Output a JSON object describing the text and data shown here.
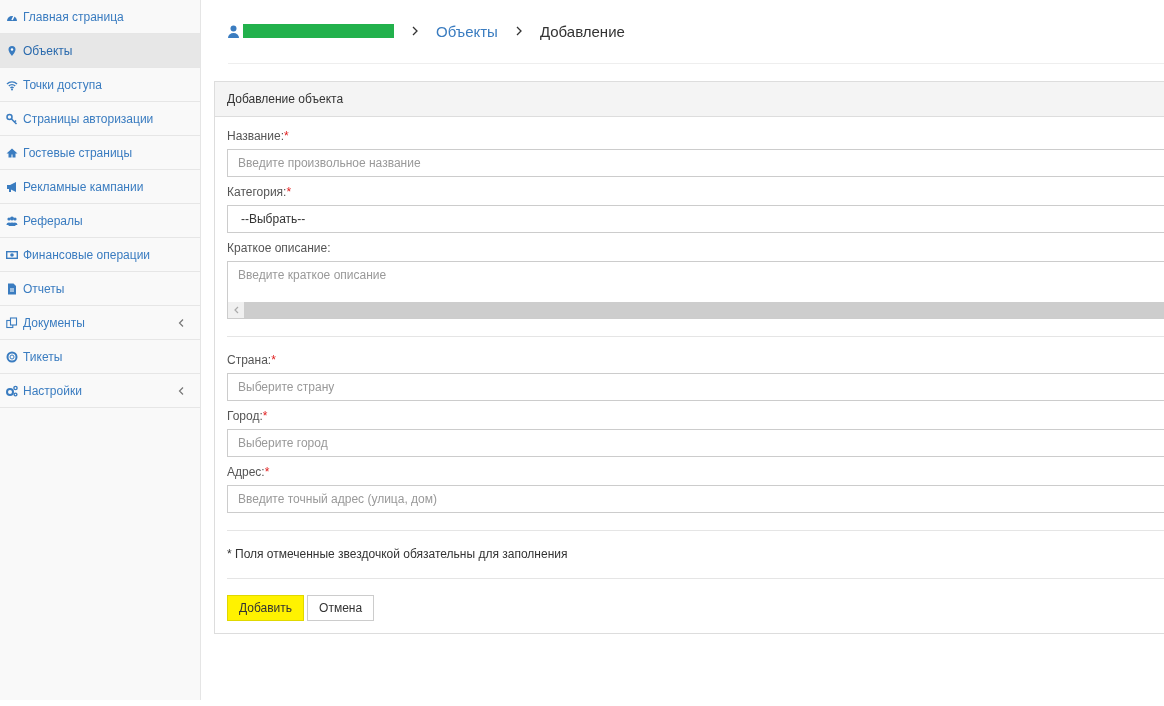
{
  "sidebar": {
    "items": [
      {
        "label": "Главная страница",
        "selected": false,
        "has_submenu": false
      },
      {
        "label": "Объекты",
        "selected": true,
        "has_submenu": false
      },
      {
        "label": "Точки доступа",
        "selected": false,
        "has_submenu": false
      },
      {
        "label": "Страницы авторизации",
        "selected": false,
        "has_submenu": false
      },
      {
        "label": "Гостевые страницы",
        "selected": false,
        "has_submenu": false
      },
      {
        "label": "Рекламные кампании",
        "selected": false,
        "has_submenu": false
      },
      {
        "label": "Рефералы",
        "selected": false,
        "has_submenu": false
      },
      {
        "label": "Финансовые операции",
        "selected": false,
        "has_submenu": false
      },
      {
        "label": "Отчеты",
        "selected": false,
        "has_submenu": false
      },
      {
        "label": "Документы",
        "selected": false,
        "has_submenu": true
      },
      {
        "label": "Тикеты",
        "selected": false,
        "has_submenu": false
      },
      {
        "label": "Настройки",
        "selected": false,
        "has_submenu": true
      }
    ]
  },
  "breadcrumb": {
    "items": [
      {
        "label": "Объекты",
        "kind": "link"
      },
      {
        "label": "Добавление",
        "kind": "current"
      }
    ]
  },
  "form": {
    "title": "Добавление объекта",
    "groups": [
      [
        {
          "label": "Название:",
          "required_mark": "*",
          "kind": "input",
          "placeholder": "Введите произвольное название"
        },
        {
          "label": "Категория:",
          "required_mark": "*",
          "kind": "select",
          "value": "--Выбрать--"
        },
        {
          "label": "Краткое описание:",
          "kind": "textarea",
          "placeholder": "Введите краткое описание"
        }
      ],
      [
        {
          "label": "Страна:",
          "required_mark": "*",
          "kind": "input",
          "placeholder": "Выберите страну"
        },
        {
          "label": "Город:",
          "required_mark": "*",
          "kind": "input",
          "placeholder": "Выберите город"
        },
        {
          "label": "Адрес:",
          "required_mark": "*",
          "kind": "input",
          "placeholder": "Введите точный адрес (улица, дом)"
        }
      ]
    ],
    "note": "* Поля отмеченные звездочкой обязательны для заполнения",
    "buttons": [
      {
        "label": "Добавить",
        "kind": "primary"
      },
      {
        "label": "Отмена",
        "kind": "default"
      }
    ]
  }
}
